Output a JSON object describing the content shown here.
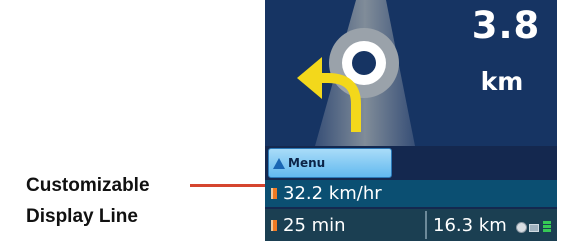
{
  "callout": {
    "line1": "Customizable",
    "line2": "Display Line"
  },
  "maneuver": {
    "icon": "roundabout-turn-left-icon",
    "distance_value": "3.8",
    "distance_unit": "km"
  },
  "menu": {
    "label": "Menu",
    "icon": "up-triangle-icon"
  },
  "display_line": {
    "icon": "flag-icon",
    "value": "32.2 km/hr"
  },
  "status_bar": {
    "time_icon": "flag-icon",
    "time_value": "25 min",
    "distance_value": "16.3 km",
    "icons": [
      "gps-icon",
      "memory-card-icon",
      "battery-icon"
    ]
  },
  "colors": {
    "nav_background": "#163463",
    "road": "#808891",
    "arrow": "#f3d81b",
    "display_line_bg": "#0b4f72",
    "status_bg": "#1b3f52",
    "menu_button": "#62b9ef",
    "callout_line": "#d5452f"
  }
}
